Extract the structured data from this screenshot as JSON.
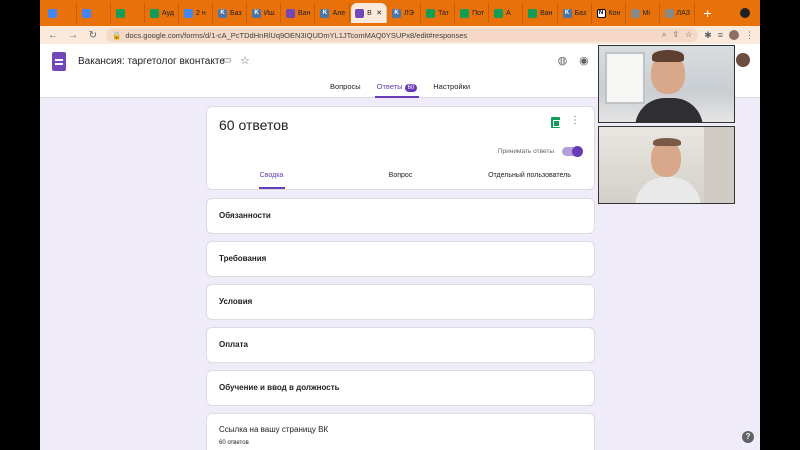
{
  "browser": {
    "tabs": [
      {
        "label": "",
        "icon": "doc-icon"
      },
      {
        "label": "",
        "icon": "doc-icon"
      },
      {
        "label": "",
        "icon": "sheets-icon"
      },
      {
        "label": "Ауд",
        "icon": "sheets-icon"
      },
      {
        "label": "2 н",
        "icon": "doc-icon"
      },
      {
        "label": "Баз",
        "icon": "vk-icon"
      },
      {
        "label": "Иш",
        "icon": "vk-icon"
      },
      {
        "label": "Ван",
        "icon": "forms-icon"
      },
      {
        "label": "Але",
        "icon": "vk-icon"
      },
      {
        "label": "В",
        "icon": "forms-icon"
      },
      {
        "label": "ЛЭ",
        "icon": "vk-icon"
      },
      {
        "label": "Тат",
        "icon": "sheets-icon"
      },
      {
        "label": "Пот",
        "icon": "sheets-icon"
      },
      {
        "label": "А",
        "icon": "sheets-icon"
      },
      {
        "label": "Ван",
        "icon": "sheets-icon"
      },
      {
        "label": "Баз",
        "icon": "vk-icon"
      },
      {
        "label": "Кон",
        "icon": "notion-icon"
      },
      {
        "label": "Mi",
        "icon": "generic-icon"
      },
      {
        "label": "ЛАЗ",
        "icon": "book-icon"
      }
    ],
    "active_tab_index": 9,
    "url": "docs.google.com/forms/d/1-cA_PcTDdHnRlUq9OEN3IQUDmYL1JTcomMAQ0YSUPx8/edit#responses"
  },
  "form": {
    "title": "Вакансия: таргетолог вконтакте",
    "nav_tabs": {
      "questions": "Вопросы",
      "responses": "Ответы",
      "responses_count": "60",
      "settings": "Настройки"
    },
    "summary": {
      "title": "60 ответов",
      "accept_label": "Принимать ответы",
      "accepting": true,
      "sub_tabs": {
        "summary": "Сводка",
        "question": "Вопрос",
        "individual": "Отдельный пользователь"
      }
    },
    "questions": [
      {
        "label": "Обязанности"
      },
      {
        "label": "Требования"
      },
      {
        "label": "Условия"
      },
      {
        "label": "Оплата"
      },
      {
        "label": "Обучение и ввод в должность"
      },
      {
        "label": "Ссылка на вашу страницу ВК",
        "subtext": "60 ответов"
      }
    ]
  },
  "colors": {
    "tab_strip": "#e8710a",
    "forms_accent": "#673ab7",
    "background": "#f0ebf8"
  }
}
